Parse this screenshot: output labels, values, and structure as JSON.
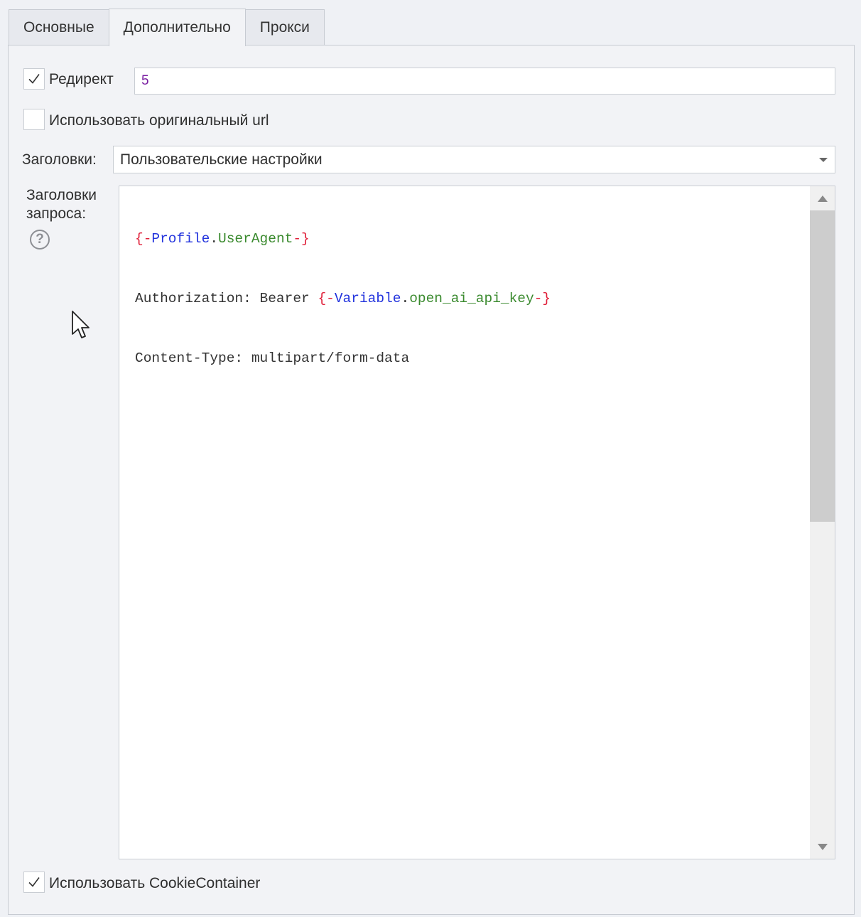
{
  "tabs": [
    {
      "label": "Основные",
      "active": false
    },
    {
      "label": "Дополнительно",
      "active": true
    },
    {
      "label": "Прокси",
      "active": false
    }
  ],
  "redirect": {
    "label": "Редирект",
    "checked": true,
    "value": "5"
  },
  "use_original_url": {
    "label": "Использовать оригинальный url",
    "checked": false
  },
  "headers": {
    "label": "Заголовки:",
    "selected": "Пользовательские настройки"
  },
  "request_headers": {
    "label_line1": "Заголовки",
    "label_line2": "запроса:",
    "help_glyph": "?",
    "line1": {
      "open": "{-",
      "object": "Profile",
      "dot": ".",
      "property": "UserAgent",
      "close": "-}"
    },
    "line2": {
      "prefix": "Authorization: Bearer ",
      "open": "{-",
      "object": "Variable",
      "dot": ".",
      "property": "open_ai_api_key",
      "close": "-}"
    },
    "line3": "Content-Type: multipart/form-data",
    "scroll_position": 0
  },
  "cookie_container": {
    "label": "Использовать CookieContainer",
    "checked": true
  },
  "colors": {
    "brace": "#e0203a",
    "object": "#2233dd",
    "property": "#3a8a2e",
    "input_value": "#7a1fa2"
  }
}
